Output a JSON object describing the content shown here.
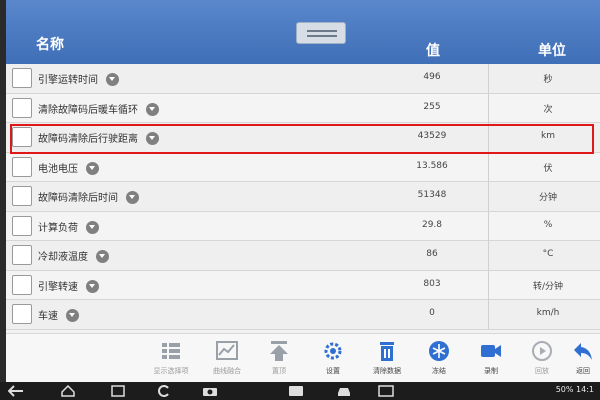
{
  "header": {
    "name": "名称",
    "value": "值",
    "unit": "单位"
  },
  "rows": [
    {
      "label": "引擎运转时间",
      "value": "496",
      "unit": "秒"
    },
    {
      "label": "清除故障码后暖车循环",
      "value": "255",
      "unit": "次"
    },
    {
      "label": "故障码清除后行驶距离",
      "value": "43529",
      "unit": "km"
    },
    {
      "label": "电池电压",
      "value": "13.586",
      "unit": "伏"
    },
    {
      "label": "故障码清除后时间",
      "value": "51348",
      "unit": "分钟"
    },
    {
      "label": "计算负荷",
      "value": "29.8",
      "unit": "%"
    },
    {
      "label": "冷却液温度",
      "value": "86",
      "unit": "°C"
    },
    {
      "label": "引擎转速",
      "value": "803",
      "unit": "转/分钟"
    },
    {
      "label": "车速",
      "value": "0",
      "unit": "km/h"
    }
  ],
  "toolbar": {
    "show_selected": "显示选择项",
    "graph_merge": "曲线融合",
    "top": "置顶",
    "settings": "设置",
    "clear_data": "清除数据",
    "freeze": "冻结",
    "record": "录制",
    "playback": "回放",
    "back": "返回"
  },
  "status": {
    "battery": "50%",
    "time": "14:1"
  },
  "colors": {
    "header": "#4a7bc2",
    "highlight": "#e01818",
    "accent_blue": "#2f6fd1"
  }
}
